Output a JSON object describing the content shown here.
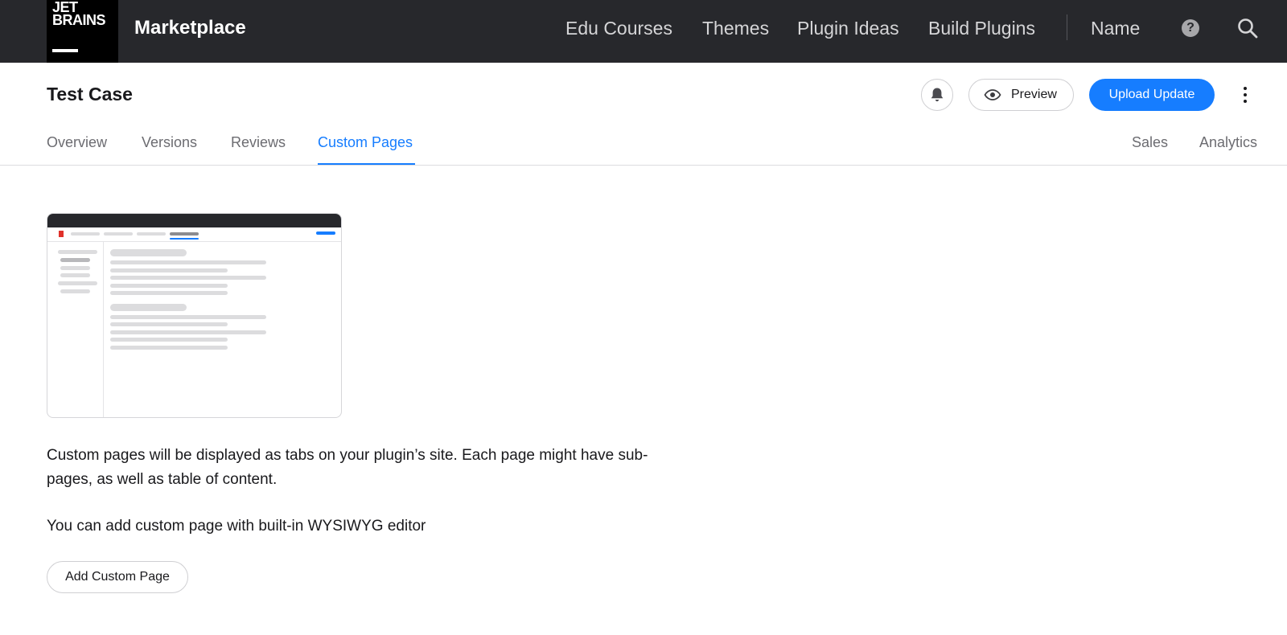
{
  "topbar": {
    "logo_line1": "JET",
    "logo_line2": "BRAINS",
    "brand": "Marketplace",
    "nav": [
      "Edu Courses",
      "Themes",
      "Plugin Ideas",
      "Build Plugins"
    ],
    "user": "Name",
    "help_icon": "question-circle-icon",
    "help_glyph": "?",
    "search_icon": "search-icon"
  },
  "header": {
    "title": "Test Case",
    "bell_icon": "bell-icon",
    "preview_label": "Preview",
    "upload_label": "Upload Update",
    "more_icon": "more-vertical-icon"
  },
  "tabs": {
    "left": [
      "Overview",
      "Versions",
      "Reviews",
      "Custom Pages"
    ],
    "right": [
      "Sales",
      "Analytics"
    ],
    "active": "Custom Pages"
  },
  "content": {
    "description": "Custom pages will be displayed as tabs on your plugin’s site. Each page might have sub-pages, as well as table of content.",
    "hint": "You can add custom page with built-in WYSIWYG editor",
    "add_button": "Add Custom Page"
  },
  "colors": {
    "accent": "#167dff",
    "topbar_bg": "#27282c",
    "text": "#19191c"
  }
}
